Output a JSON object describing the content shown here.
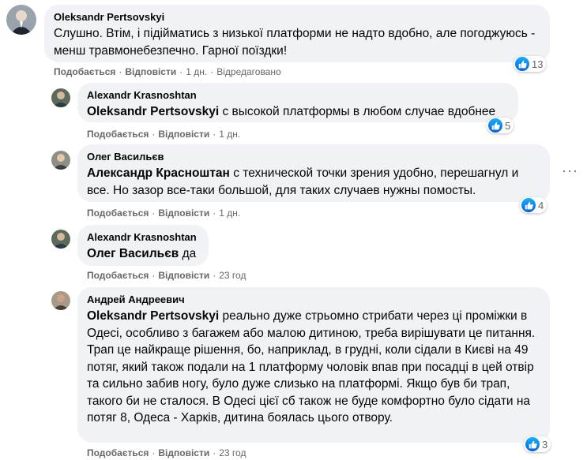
{
  "comments": [
    {
      "author": "Oleksandr Pertsovskyi",
      "mention": "",
      "text": "Слушно. Втім, і підійматись з низької платформи не надто вдобно, але погоджуюсь - менш травмонебезпечно. Гарної поїздки!",
      "like": "Подобається",
      "reply": "Відповісти",
      "time": "1 дн.",
      "edited": "Відредаговано",
      "reactions": "13"
    },
    {
      "author": "Alexandr Krasnoshtan",
      "mention": "Oleksandr Pertsovskyi",
      "text": "с высокой платформы в любом случае вдобнее",
      "like": "Подобається",
      "reply": "Відповісти",
      "time": "1 дн.",
      "reactions": "5"
    },
    {
      "author": "Олег Васильєв",
      "mention": "Александр Красноштан",
      "text": "с технической точки зрения удобно, перешагнул и все. Но зазор все-таки большой, для таких случаев нужны помосты.",
      "like": "Подобається",
      "reply": "Відповісти",
      "time": "1 дн.",
      "reactions": "4",
      "more_icon": "more-horizontal-icon"
    },
    {
      "author": "Alexandr Krasnoshtan",
      "mention": "Олег Васильєв",
      "text": "да",
      "like": "Подобається",
      "reply": "Відповісти",
      "time": "23 год"
    },
    {
      "author": "Андрей Андреевич",
      "mention": "Oleksandr Pertsovskyi",
      "text": "реально дуже стрьомно стрибати через ці проміжки в Одесі, особливо з багажем або малою дитиною, треба вирішувати це питання. Трап це найкраще рішення, бо, наприклад, в грудні, коли сідали в Києві на 49 потяг, який також подали на 1 платформу чоловік впав при посадці в цей отвір та сильно забив ногу, було дуже слизько на платформі. Якщо був би трап, такого би не сталося. В Одесі цієї сб також не буде комфортно було сідати на потяг 8, Одеса - Харків, дитина боялась цього отвору.",
      "like": "Подобається",
      "reply": "Відповісти",
      "time": "23 год",
      "reactions": "3"
    }
  ],
  "colors": {
    "bubble": "#f0f2f5",
    "secondary_text": "#65676b",
    "like_blue": "#1877f2"
  },
  "icons": {
    "reaction": "like-thumb-icon",
    "avatar": "user-avatar-icon"
  }
}
